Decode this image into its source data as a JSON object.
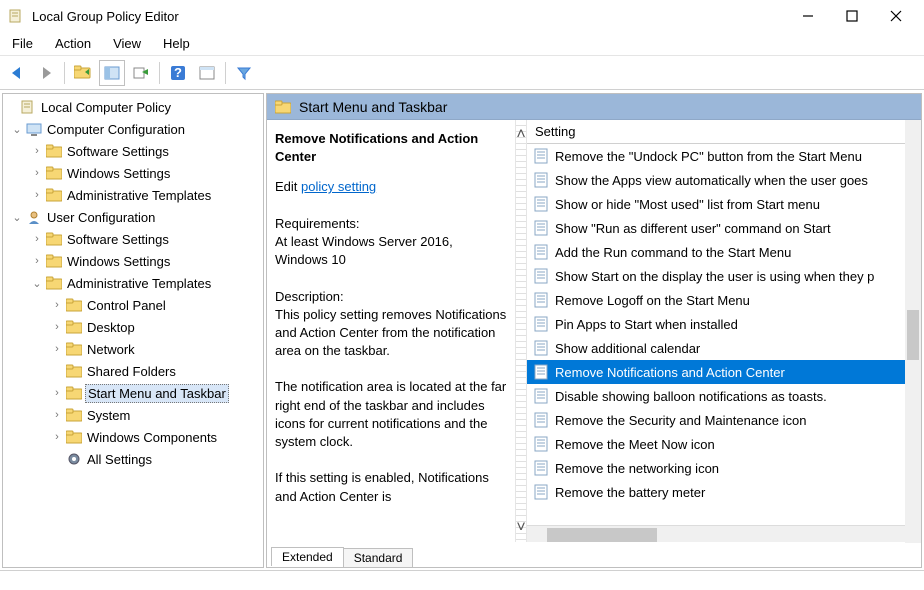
{
  "window": {
    "title": "Local Group Policy Editor"
  },
  "menu": {
    "file": "File",
    "action": "Action",
    "view": "View",
    "help": "Help"
  },
  "tree": {
    "root": "Local Computer Policy",
    "cc": "Computer Configuration",
    "cc_sw": "Software Settings",
    "cc_win": "Windows Settings",
    "cc_adm": "Administrative Templates",
    "uc": "User Configuration",
    "uc_sw": "Software Settings",
    "uc_win": "Windows Settings",
    "uc_adm": "Administrative Templates",
    "cp": "Control Panel",
    "dk": "Desktop",
    "nw": "Network",
    "sf": "Shared Folders",
    "sm": "Start Menu and Taskbar",
    "sys": "System",
    "wc": "Windows Components",
    "all": "All Settings"
  },
  "pane": {
    "title": "Start Menu and Taskbar"
  },
  "detail": {
    "title": "Remove Notifications and Action Center",
    "edit_prefix": "Edit ",
    "edit_link": "policy setting",
    "req_label": "Requirements:",
    "req_text": "At least Windows Server 2016, Windows 10",
    "desc_label": "Description:",
    "desc_p1": "This policy setting removes Notifications and Action Center from the notification area on the taskbar.",
    "desc_p2": "The notification area is located at the far right end of the taskbar and includes icons for current notifications and the system clock.",
    "desc_p3": "If this setting is enabled, Notifications and Action Center is"
  },
  "listhdr": "Setting",
  "settings": [
    "Remove the \"Undock PC\" button from the Start Menu",
    "Show the Apps view automatically when the user goes",
    "Show or hide \"Most used\" list from Start menu",
    "Show \"Run as different user\" command on Start",
    "Add the Run command to the Start Menu",
    "Show Start on the display the user is using when they p",
    "Remove Logoff on the Start Menu",
    "Pin Apps to Start when installed",
    "Show additional calendar",
    "Remove Notifications and Action Center",
    "Disable showing balloon notifications as toasts.",
    "Remove the Security and Maintenance icon",
    "Remove the Meet Now icon",
    "Remove the networking icon",
    "Remove the battery meter"
  ],
  "selected_index": 9,
  "tabs": {
    "extended": "Extended",
    "standard": "Standard"
  }
}
